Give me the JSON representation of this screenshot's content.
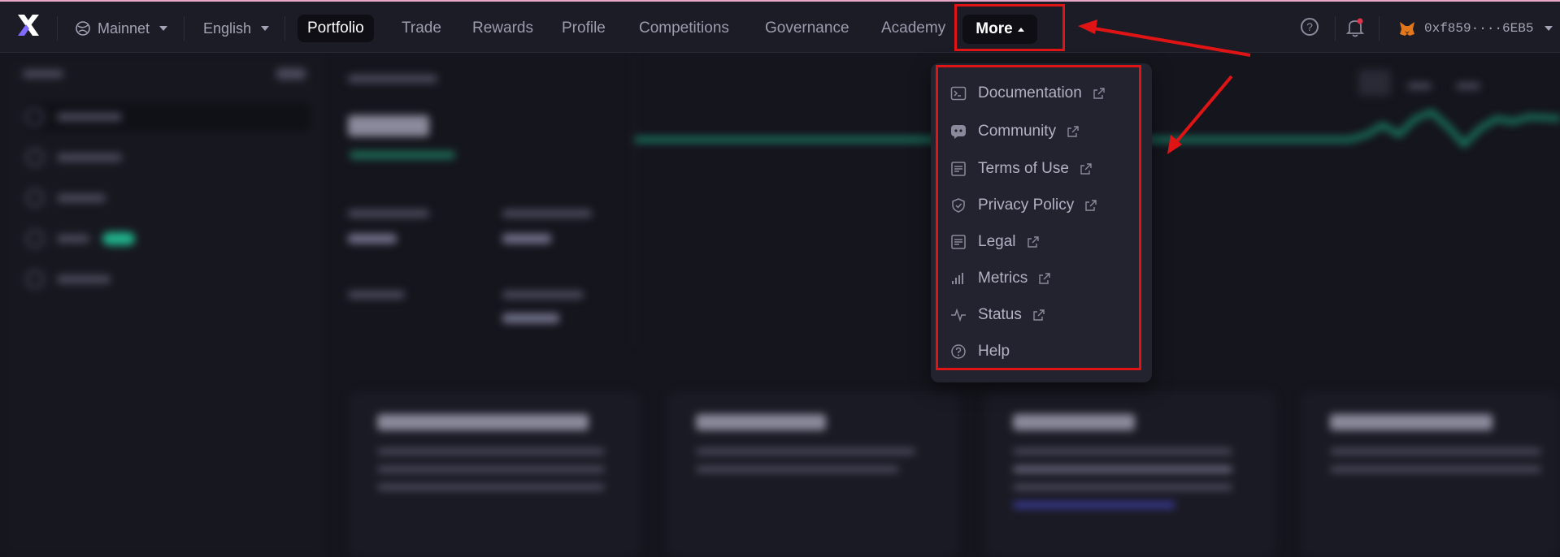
{
  "nav": {
    "network": "Mainnet",
    "language": "English",
    "items": [
      {
        "label": "Portfolio"
      },
      {
        "label": "Trade"
      },
      {
        "label": "Rewards"
      },
      {
        "label": "Profile"
      },
      {
        "label": "Competitions"
      },
      {
        "label": "Governance"
      },
      {
        "label": "Academy"
      }
    ],
    "more_label": "More",
    "help_glyph": "?",
    "wallet_address": "0xf859····6EB5"
  },
  "more_menu": {
    "items": [
      {
        "label": "Documentation",
        "icon": "terminal-icon",
        "external": true
      },
      {
        "label": "Community",
        "icon": "discord-icon",
        "external": true
      },
      {
        "label": "Terms of Use",
        "icon": "document-icon",
        "external": true
      },
      {
        "label": "Privacy Policy",
        "icon": "shield-icon",
        "external": true
      },
      {
        "label": "Legal",
        "icon": "document-icon",
        "external": true
      },
      {
        "label": "Metrics",
        "icon": "bar-chart-icon",
        "external": true
      },
      {
        "label": "Status",
        "icon": "pulse-icon",
        "external": true
      },
      {
        "label": "Help",
        "icon": "help-circle-icon",
        "external": false
      }
    ]
  },
  "colors": {
    "background": "#15151d",
    "topbar": "#1c1c26",
    "menu": "#23232f",
    "highlight": "#e01414",
    "accent": "#7f6cff"
  }
}
